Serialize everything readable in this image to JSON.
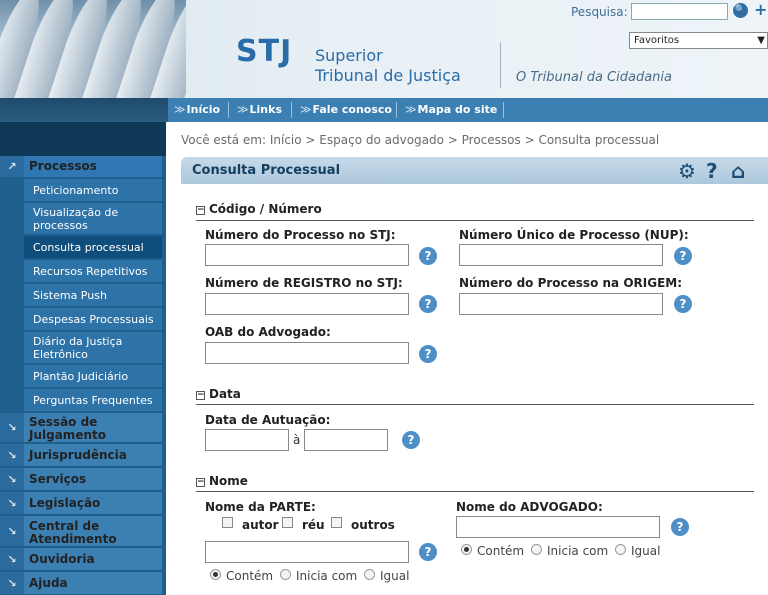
{
  "header": {
    "logo": "STJ",
    "court_name_line1": "Superior",
    "court_name_line2": "Tribunal de Justiça",
    "tagline": "O Tribunal da Cidadania",
    "search_label": "Pesquisa:",
    "search_value": "",
    "favorites_select": "Favoritos"
  },
  "topnav": {
    "items": [
      {
        "label": "Início"
      },
      {
        "label": "Links"
      },
      {
        "label": "Fale conosco"
      },
      {
        "label": "Mapa do site"
      }
    ]
  },
  "breadcrumb": "Você está em: Início > Espaço do advogado > Processos > Consulta processual",
  "sidebar": {
    "sections": [
      {
        "label": "Processos",
        "sub": [
          "Peticionamento",
          "Visualização de processos",
          "Consulta processual",
          "Recursos Repetitivos",
          "Sistema Push",
          "Despesas Processuais",
          "Diário da Justiça Eletrônico",
          "Plantão Judiciário",
          "Perguntas Frequentes"
        ]
      },
      {
        "label": "Sessão de Julgamento"
      },
      {
        "label": "Jurisprudência"
      },
      {
        "label": "Serviços"
      },
      {
        "label": "Legislação"
      },
      {
        "label": "Central de Atendimento"
      },
      {
        "label": "Ouvidoria"
      },
      {
        "label": "Ajuda"
      }
    ]
  },
  "panel": {
    "title": "Consulta Processual",
    "sections": {
      "codigo": "Código / Número",
      "data": "Data",
      "nome": "Nome"
    },
    "fields": {
      "numero_stj": "Número do Processo no STJ:",
      "nup": "Número Único de Processo (NUP):",
      "registro_stj": "Número de REGISTRO no STJ:",
      "origem": "Número do Processo na ORIGEM:",
      "oab": "OAB do Advogado:",
      "data_autuacao": "Data de Autuação:",
      "date_separator": "à",
      "nome_parte": "Nome da PARTE:",
      "nome_advogado": "Nome do ADVOGADO:"
    },
    "parte_checkboxes": [
      "autor",
      "réu",
      "outros"
    ],
    "match_options": [
      "Contém",
      "Inicia com",
      "Igual"
    ],
    "parte_match_selected": "Contém",
    "advogado_match_selected": "Contém",
    "help_symbol": "?"
  },
  "colors": {
    "nav_blue": "#3b7fb3",
    "sidebar_dark": "#1f5f8e",
    "active_item": "#0f4d7d",
    "help_icon": "#4f8fc7",
    "logo_blue": "#2a6ca8"
  }
}
